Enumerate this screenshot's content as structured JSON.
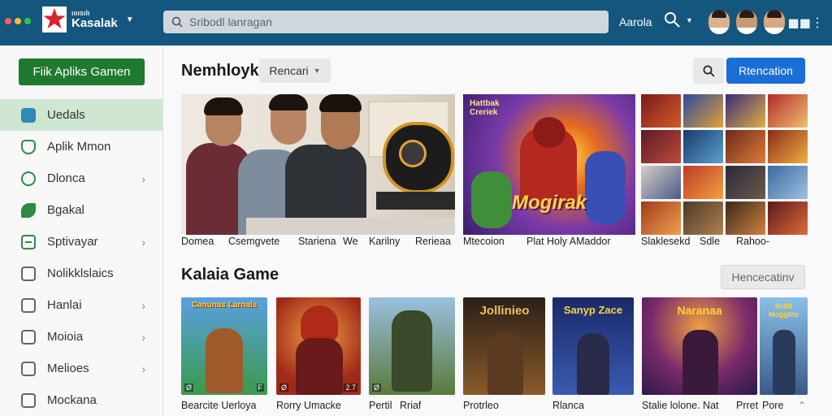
{
  "header": {
    "logo_small": "ıııısılı",
    "logo_big": "Kasalak",
    "search_placeholder": "Sribodl lanragan",
    "link": "Aarola"
  },
  "sidebar": {
    "primary_button": "Fiik Apliks Gamen",
    "items": [
      {
        "label": "Uedals",
        "active": true,
        "chevron": false
      },
      {
        "label": "Aplik Mmon",
        "active": false,
        "chevron": false
      },
      {
        "label": "Dlonca",
        "active": false,
        "chevron": true
      },
      {
        "label": "Bgakal",
        "active": false,
        "chevron": false
      },
      {
        "label": "Sptivayar",
        "active": false,
        "chevron": true
      },
      {
        "label": "Nolikklslaics",
        "active": false,
        "chevron": false
      },
      {
        "label": "Hanlai",
        "active": false,
        "chevron": true
      },
      {
        "label": "Moioia",
        "active": false,
        "chevron": true
      },
      {
        "label": "Melioes",
        "active": false,
        "chevron": true
      },
      {
        "label": "Mockana",
        "active": false,
        "chevron": false
      }
    ]
  },
  "main": {
    "section1_title": "Nemhloyk",
    "dropdown_label": "Rencari",
    "blue_button": "Rtencation",
    "hero_captions": [
      "Domea",
      "Csemgvete",
      "Stariena",
      "We",
      "Karilny",
      "Rerieaa"
    ],
    "feature_caption": "Mtecoion",
    "feature_caption2": "Plat Holy AMaddor",
    "feature_art_title": "Mogirak",
    "feature_art_tag": "Hattbak Creriek",
    "grid_captions": [
      "Slaklesekd",
      "Sdle",
      "Rahoo-"
    ],
    "section2_title": "Kalaia Game",
    "ghost_button": "Hencecatinv",
    "games": [
      {
        "title": "Bearcite Uerloya",
        "art": "Canunas Larnals",
        "badge": "Ø",
        "badge2": "F"
      },
      {
        "title": "Rorry Umacke",
        "art": "",
        "badge": "Ø",
        "badge2": "2.7"
      },
      {
        "title": "Pertil",
        "title2": "Rriaf",
        "art": "",
        "badge": "Ø",
        "badge2": ""
      },
      {
        "title": "Protrleo",
        "art": "Jollinieo",
        "badge": "",
        "badge2": ""
      },
      {
        "title": "Rlanca",
        "art": "Sanyp Zace",
        "badge": "",
        "badge2": ""
      },
      {
        "title": "Stalie lolone. Nat",
        "art": "Naranaa",
        "badge": "",
        "badge2": ""
      },
      {
        "title": "Prret",
        "title2": "Pore",
        "art": "Rrifif Mogglite",
        "badge": "",
        "badge2": ""
      }
    ]
  },
  "colors": {
    "topbar": "#15567e",
    "primary": "#1f7a2e",
    "accent_blue": "#1a6ed8",
    "sidebar_active": "#cfe6d2"
  }
}
